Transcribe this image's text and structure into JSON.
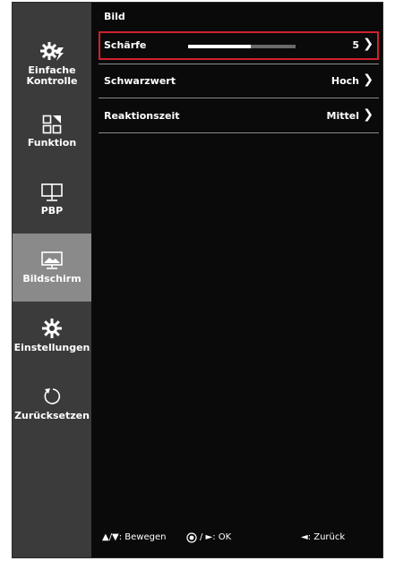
{
  "sidebar": {
    "items": [
      {
        "label_line1": "Einfache",
        "label_line2": "Kontrolle",
        "icon": "gear-lightning-icon"
      },
      {
        "label_line1": "Funktion",
        "label_line2": "",
        "icon": "grid-icon"
      },
      {
        "label_line1": "PBP",
        "label_line2": "",
        "icon": "dual-monitor-icon"
      },
      {
        "label_line1": "Bildschirm",
        "label_line2": "",
        "icon": "monitor-image-icon",
        "active": true
      },
      {
        "label_line1": "Einstellungen",
        "label_line2": "",
        "icon": "gear-icon"
      },
      {
        "label_line1": "Zurücksetzen",
        "label_line2": "",
        "icon": "reset-arrow-icon"
      }
    ]
  },
  "main": {
    "section_title": "Bild",
    "rows": [
      {
        "label": "Schärfe",
        "value": "5",
        "chevron": "❯",
        "slider_fraction": 0.58,
        "selected": true
      },
      {
        "label": "Schwarzwert",
        "value": "Hoch",
        "chevron": "❯"
      },
      {
        "label": "Reaktionszeit",
        "value": "Mittel",
        "chevron": "❯"
      }
    ]
  },
  "footer": {
    "move": "▲/▼: Bewegen",
    "ok": "/ ►: OK",
    "back": "◄: Zurück"
  },
  "colors": {
    "sidebar_bg": "#3b3b3b",
    "active_item_bg": "#8a8a8a",
    "screen_bg": "#0a0a0a",
    "selection_border": "#d0202e",
    "slider_track": "#6a6a6a",
    "slider_fill": "#ffffff"
  }
}
